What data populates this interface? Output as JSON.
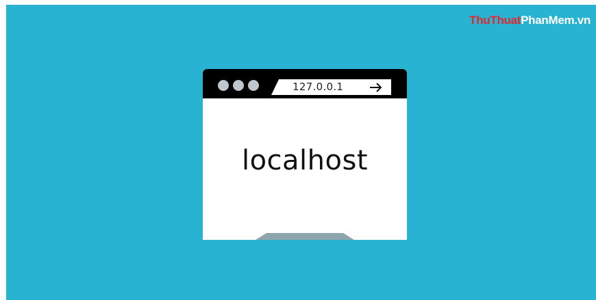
{
  "watermark": {
    "part1": "ThuThuat",
    "part2": "PhanMem.vn"
  },
  "browser": {
    "window_dots": [
      "dot",
      "dot",
      "dot"
    ],
    "address_bar": {
      "url": "127.0.0.1",
      "go_icon": "right-arrow-icon"
    },
    "page_text": "localhost"
  },
  "colors": {
    "background": "#29b3d3",
    "titlebar": "#000000",
    "window_dot": "#bfc6cc",
    "stand": "#8ea5ad",
    "watermark_red": "#e6262d",
    "watermark_white": "#ffffff"
  }
}
